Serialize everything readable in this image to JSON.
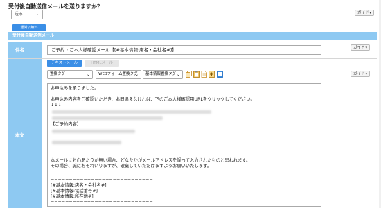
{
  "page": {
    "question": "受付後自動送信メールを送りますか？",
    "send_option": "送る",
    "toggle_button": "通常 / 無料",
    "section_title": "受付後自動送信メール",
    "guide_label": "ガイド",
    "accent_color": "#3a8ee6",
    "header_color": "#8ec9f2"
  },
  "subject": {
    "label": "件名",
    "value": "ご予約・ご本人様確認メール【[#基本情報:店名・会社名#]】"
  },
  "editor": {
    "label": "本文",
    "tab_text": "テキストメール",
    "tab_html": "HTMLメール",
    "select_1": "置換タグ",
    "select_2": "WEBフォーム置換タグ",
    "select_3": "基本情報置換タグ",
    "toolbar_icons": [
      "copy-icon",
      "paste-icon",
      "document-icon",
      "insert-icon",
      "preview-icon"
    ],
    "lines": {
      "l1": "お申込みを承りました。",
      "l2": "お申込み内容をご確認いただき、お間違えなければ、下のご本人様確認用URLをクリックしてください。",
      "l3": "↓↓↓",
      "l4": "【ご予約内容】",
      "l5": "本メールにお心あたりが無い場合、どなたかがメールアドレスを誤って入力されたものと思われます。",
      "l6": "その場合、誠におそれいりますが、破棄していただけますようお願いいたします。",
      "l7": "============================",
      "l8": "[#基本情報:店名・会社名#]",
      "l9": "[#基本情報:電話番号#]",
      "l10": "[#基本情報:所在地#]",
      "l11": "============================"
    }
  }
}
